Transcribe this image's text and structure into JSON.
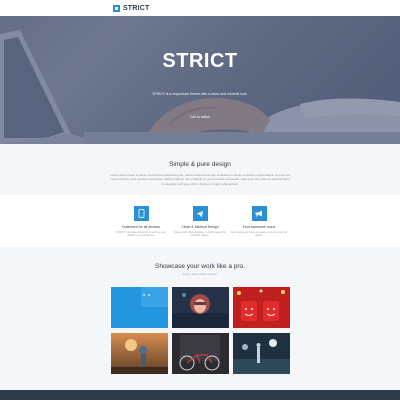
{
  "nav": {
    "brand": "STRICT"
  },
  "hero": {
    "title": "STRICT",
    "subtitle": "STRICT is a responsive theme with a clean and minimal look.",
    "cta": "Call to action"
  },
  "intro": {
    "title": "Simple & pure design",
    "description": "Lorem ipsum dolor sit amet, consectetur adipisicing elit, sed do eiusmod tempor incididunt ut labore et dolore magna aliqua. Ut enim ad minim veniam, quis nostrud exercitation ullamco laboris nisi ut aliquip ex ea commodo consequat. Duis aute irure dolor in reprehenderit in voluptate velit esse cillum dolore eu fugiat nulla pariatur."
  },
  "features": [
    {
      "icon": "mobile-icon",
      "title": "Optimized for all devices",
      "desc": "STRICT has been designed to work on any platform or smartphone."
    },
    {
      "icon": "paper-plane-icon",
      "title": "Clean & Minimal Design",
      "desc": "Clean and minimal design is what makes this template unique."
    },
    {
      "icon": "megaphone-icon",
      "title": "Font Awesome Icons",
      "desc": "Font Awesome icons are easy to use and can be styled."
    }
  ],
  "showcase": {
    "title": "Showcase your work like a pro.",
    "subtitle": "Lorem ipsum dolor sit amet"
  },
  "colors": {
    "accent": "#2a8fd3",
    "hero_overlay": "#465276",
    "footer": "#2e3a49",
    "background": "#f4f6f8"
  }
}
